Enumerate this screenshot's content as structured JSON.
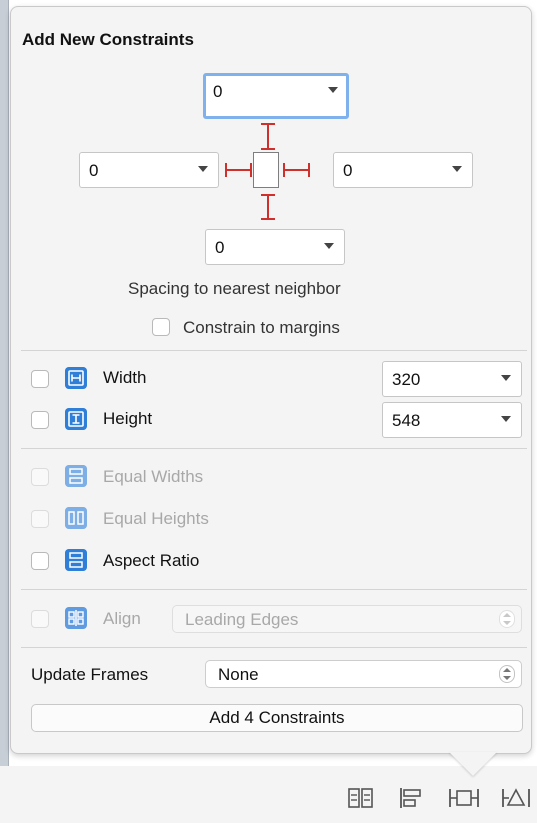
{
  "popover": {
    "title": "Add New Constraints",
    "spacing": {
      "top": "0",
      "left": "0",
      "right": "0",
      "bottom": "0",
      "caption": "Spacing to nearest neighbor",
      "constrain_margins_label": "Constrain to margins",
      "constrain_margins_checked": false
    },
    "size": {
      "width_label": "Width",
      "width_value": "320",
      "width_checked": false,
      "height_label": "Height",
      "height_value": "548",
      "height_checked": false
    },
    "equal": {
      "equal_widths_label": "Equal Widths",
      "equal_heights_label": "Equal Heights",
      "aspect_ratio_label": "Aspect Ratio"
    },
    "align": {
      "label": "Align",
      "value": "Leading Edges"
    },
    "update_frames": {
      "label": "Update Frames",
      "value": "None"
    },
    "add_button_label": "Add 4 Constraints"
  },
  "toolbar": {
    "icons": [
      "stack-icon",
      "align-icon",
      "pin-icon",
      "resolve-issues-icon"
    ]
  },
  "colors": {
    "strut_red": "#d0302c",
    "icon_blue": "#2f7fd8",
    "focus_ring": "#7fb2ec"
  }
}
